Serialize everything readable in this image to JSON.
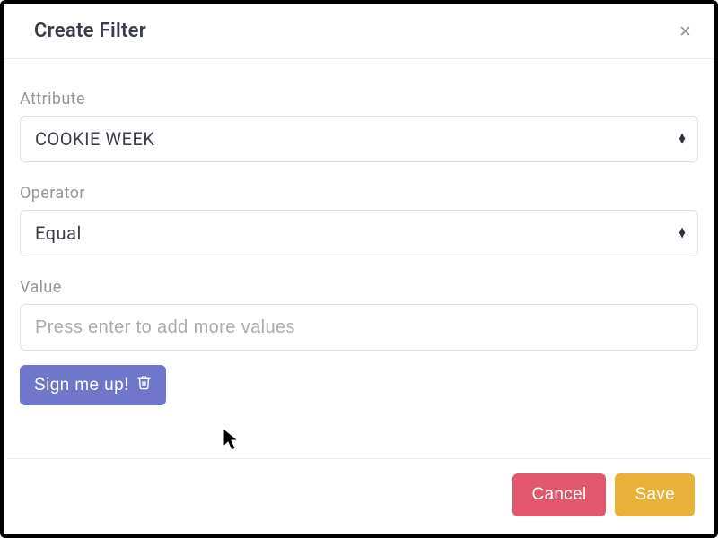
{
  "header": {
    "title": "Create Filter",
    "close_symbol": "×"
  },
  "fields": {
    "attribute": {
      "label": "Attribute",
      "value": "COOKIE WEEK"
    },
    "operator": {
      "label": "Operator",
      "value": "Equal"
    },
    "value": {
      "label": "Value",
      "placeholder": "Press enter to add more values",
      "current": ""
    }
  },
  "chip": {
    "label": "Sign me up!"
  },
  "footer": {
    "cancel_label": "Cancel",
    "save_label": "Save"
  },
  "colors": {
    "chip_bg": "#7076c9",
    "cancel_bg": "#e2586b",
    "save_bg": "#e7b237"
  }
}
